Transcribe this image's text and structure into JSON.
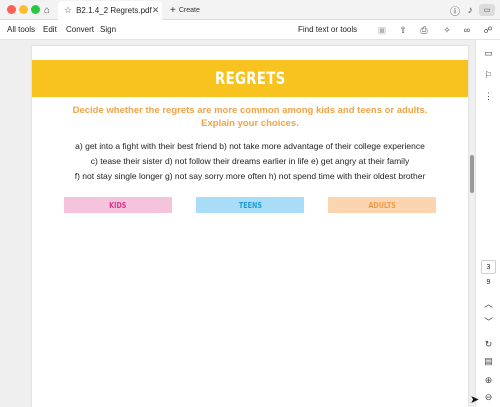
{
  "browser": {
    "tab_title": "B2.1.4_2 Regrets.pdf",
    "new_tab_label": "Create"
  },
  "menu": {
    "items": [
      "All tools",
      "Edit",
      "Convert",
      "Sign"
    ],
    "find_label": "Find text or tools"
  },
  "document": {
    "title": "REGRETS",
    "instructions": [
      "Decide whether the regrets are more common among kids and teens or adults.",
      "Explain your choices."
    ],
    "regret_lines": [
      "a) get into a fight with their best friend     b) not take more advantage of their college experience",
      "c) tease their sister     d) not follow their dreams earlier in life     e) get angry at their family",
      "f) not stay single longer    g) not say sorry more often    h) not spend time with their oldest brother"
    ],
    "categories": [
      {
        "label": "KIDS",
        "bg": "#f6c3dc",
        "color": "#e0338b"
      },
      {
        "label": "TEENS",
        "bg": "#a9ddf7",
        "color": "#1c9bd6"
      },
      {
        "label": "ADULTS",
        "bg": "#fbd5b0",
        "color": "#ef9b45"
      }
    ]
  },
  "navigation": {
    "current_page": "3",
    "total_pages": "9"
  },
  "colors": {
    "banner": "#f8c21f",
    "instructions": "#f0a447"
  },
  "icons": {
    "tabbar": [
      "home-icon",
      "star-icon",
      "close-icon",
      "plus-icon",
      "help-icon",
      "bell-icon"
    ],
    "toolbar": [
      "page-tools-icon",
      "cloud-upload-icon",
      "print-icon",
      "ai-assistant-icon",
      "link-icon",
      "share-icon"
    ],
    "sidebar": [
      "comment-icon",
      "bookmark-icon",
      "more-tools-icon",
      "chevron-up-icon",
      "chevron-down-icon",
      "refresh-icon",
      "save-icon",
      "zoom-in-icon",
      "zoom-out-icon"
    ]
  }
}
